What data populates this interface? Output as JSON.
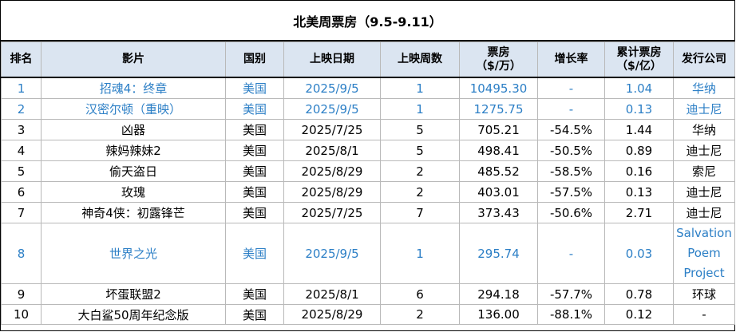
{
  "title": "北美周票房（9.5-9.11）",
  "columns": {
    "rank": "排名",
    "film": "影片",
    "country": "国别",
    "release": "上映日期",
    "weeks": "上映周数",
    "gross_l1": "票房",
    "gross_l2": "（$/万）",
    "change": "增长率",
    "cum_l1": "累计票房",
    "cum_l2": "（$/亿）",
    "distributor": "发行公司"
  },
  "rows": [
    {
      "rank": "1",
      "film": "招魂4：终章",
      "country": "美国",
      "release": "2025/9/5",
      "weeks": "1",
      "gross": "10495.30",
      "change": "-",
      "cum": "1.04",
      "distributor": "华纳",
      "highlight": true
    },
    {
      "rank": "2",
      "film": "汉密尔顿（重映）",
      "country": "美国",
      "release": "2025/9/5",
      "weeks": "1",
      "gross": "1275.75",
      "change": "-",
      "cum": "0.13",
      "distributor": "迪士尼",
      "highlight": true
    },
    {
      "rank": "3",
      "film": "凶器",
      "country": "美国",
      "release": "2025/7/25",
      "weeks": "5",
      "gross": "705.21",
      "change": "-54.5%",
      "cum": "1.44",
      "distributor": "华纳",
      "highlight": false
    },
    {
      "rank": "4",
      "film": "辣妈辣妹2",
      "country": "美国",
      "release": "2025/8/1",
      "weeks": "5",
      "gross": "498.41",
      "change": "-50.5%",
      "cum": "0.89",
      "distributor": "迪士尼",
      "highlight": false
    },
    {
      "rank": "5",
      "film": "偷天盗日",
      "country": "美国",
      "release": "2025/8/29",
      "weeks": "2",
      "gross": "485.52",
      "change": "-58.5%",
      "cum": "0.16",
      "distributor": "索尼",
      "highlight": false
    },
    {
      "rank": "6",
      "film": "玫瑰",
      "country": "美国",
      "release": "2025/8/29",
      "weeks": "2",
      "gross": "403.01",
      "change": "-57.5%",
      "cum": "0.13",
      "distributor": "迪士尼",
      "highlight": false
    },
    {
      "rank": "7",
      "film": "神奇4侠：初露锋芒",
      "country": "美国",
      "release": "2025/7/25",
      "weeks": "7",
      "gross": "373.43",
      "change": "-50.6%",
      "cum": "2.71",
      "distributor": "迪士尼",
      "highlight": false
    },
    {
      "rank": "8",
      "film": "世界之光",
      "country": "美国",
      "release": "2025/9/5",
      "weeks": "1",
      "gross": "295.74",
      "change": "-",
      "cum": "0.03",
      "distributor": "Salvation Poem Project",
      "highlight": true
    },
    {
      "rank": "9",
      "film": "坏蛋联盟2",
      "country": "美国",
      "release": "2025/8/1",
      "weeks": "6",
      "gross": "294.18",
      "change": "-57.7%",
      "cum": "0.78",
      "distributor": "环球",
      "highlight": false
    },
    {
      "rank": "10",
      "film": "大白鲨50周年纪念版",
      "country": "美国",
      "release": "2025/8/29",
      "weeks": "2",
      "gross": "136.00",
      "change": "-88.1%",
      "cum": "0.12",
      "distributor": "-",
      "highlight": false
    }
  ]
}
